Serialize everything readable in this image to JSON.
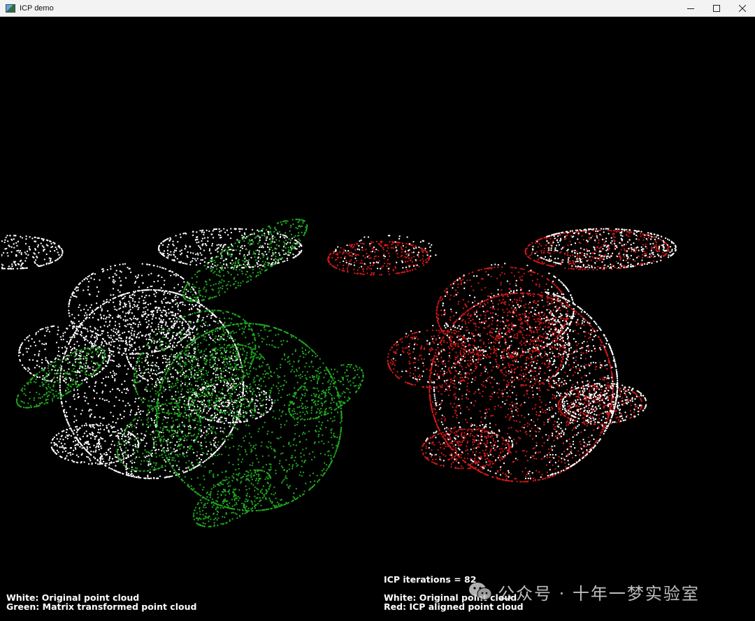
{
  "window": {
    "title": "ICP demo",
    "buttons": {
      "minimize": "minimize-icon",
      "maximize": "maximize-icon",
      "close": "close-icon"
    }
  },
  "colors": {
    "background": "#000000",
    "original": "#ffffff",
    "transformed": "#1fa81f",
    "aligned": "#d01818"
  },
  "viewports": {
    "left": {
      "line1": "White: Original point cloud",
      "line2": "Green: Matrix transformed point cloud"
    },
    "right": {
      "iterations": "ICP iterations = 82",
      "line1": "White: Original point cloud",
      "line2": "Red: ICP aligned point cloud"
    }
  },
  "watermark": {
    "logo": "wechat-icon",
    "text": "公众号 · 十年一梦实验室"
  }
}
